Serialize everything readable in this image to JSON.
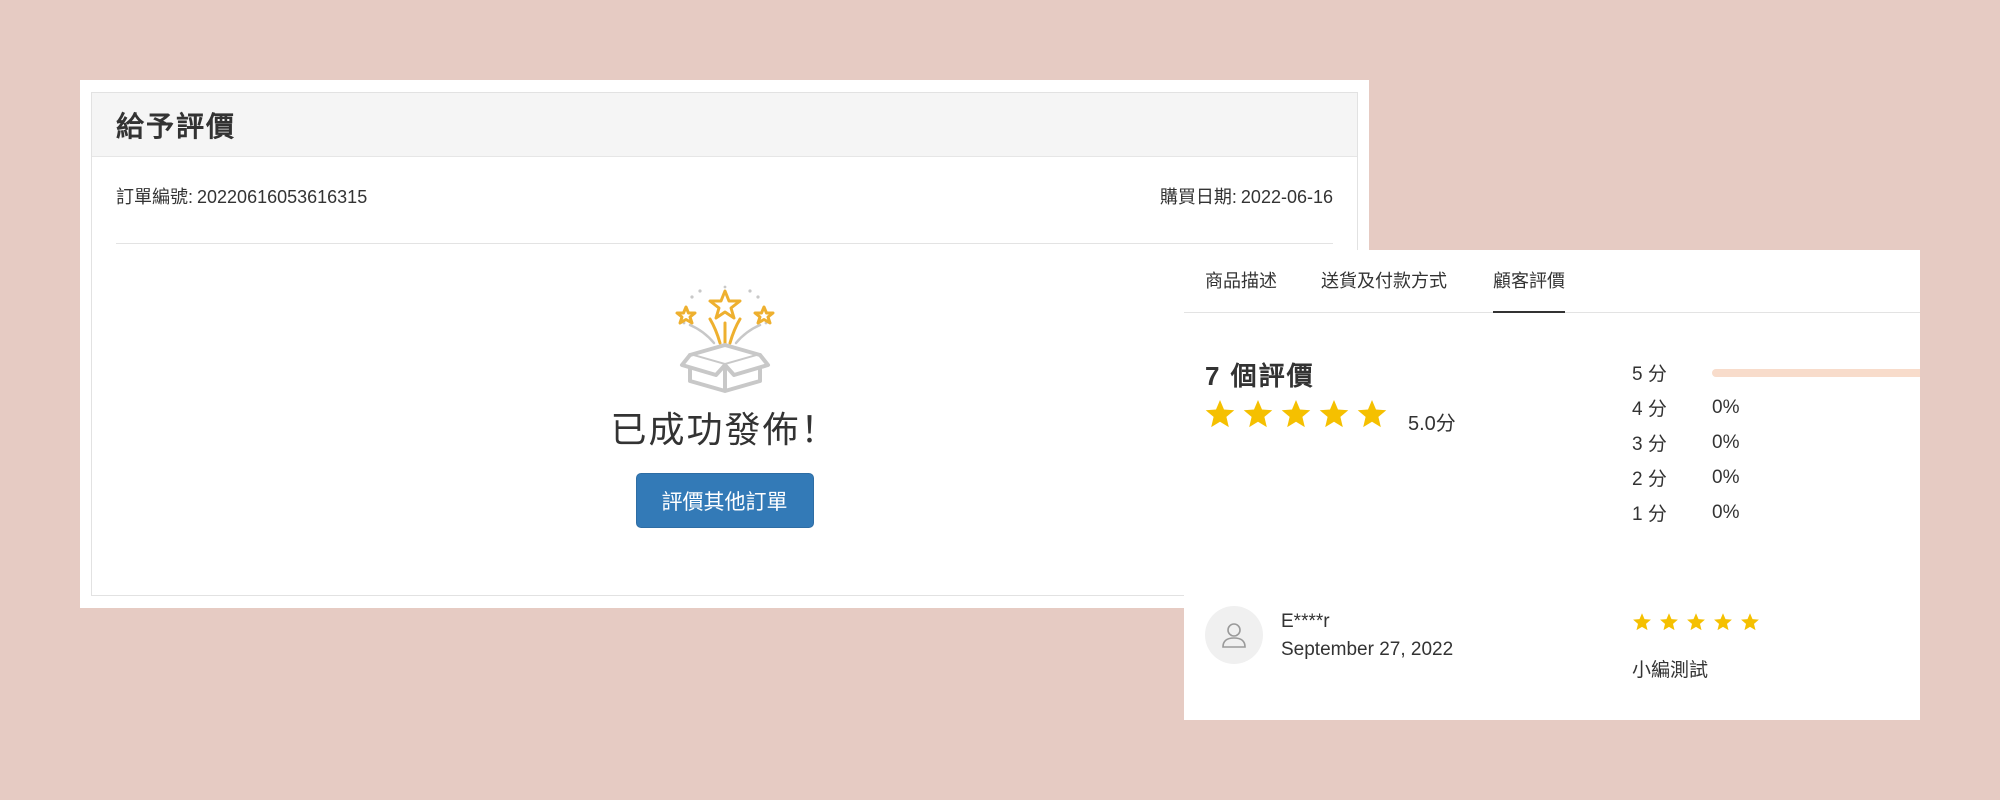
{
  "review_form": {
    "title": "給予評價",
    "order_label": "訂單編號:",
    "order_number": "20220616053616315",
    "date_label": "購買日期:",
    "date_value": "2022-06-16",
    "success_message": "已成功發佈！",
    "other_orders_button": "評價其他訂單",
    "icon": "gift-box-stars-icon"
  },
  "product_reviews": {
    "tabs": [
      {
        "label": "商品描述",
        "active": false
      },
      {
        "label": "送貨及付款方式",
        "active": false
      },
      {
        "label": "顧客評價",
        "active": true
      }
    ],
    "summary": {
      "count_text": "7 個評價",
      "average_stars": 5,
      "score_text": "5.0分"
    },
    "distribution": [
      {
        "label": "5 分",
        "percent": 100,
        "percent_text": ""
      },
      {
        "label": "4 分",
        "percent": 0,
        "percent_text": "0%"
      },
      {
        "label": "3 分",
        "percent": 0,
        "percent_text": "0%"
      },
      {
        "label": "2 分",
        "percent": 0,
        "percent_text": "0%"
      },
      {
        "label": "1 分",
        "percent": 0,
        "percent_text": "0%"
      }
    ],
    "review": {
      "reviewer": "E****r",
      "date": "September 27, 2022",
      "stars": 5,
      "text": "小編測試"
    }
  },
  "colors": {
    "page_background": "#e6cbc3",
    "primary_button": "#337ab7",
    "star": "#f5c000",
    "bar_fill": "#f8dccb",
    "icon_gold": "#eeb02f",
    "icon_gray": "#c8c8c8"
  }
}
